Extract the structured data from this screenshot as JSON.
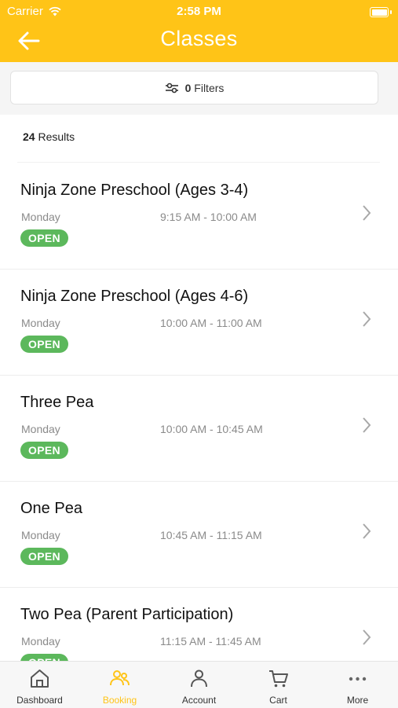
{
  "status_bar": {
    "carrier": "Carrier",
    "time": "2:58 PM"
  },
  "header": {
    "title": "Classes"
  },
  "filters": {
    "label": "Filters",
    "count": "0"
  },
  "results": {
    "count": "24",
    "label": "Results"
  },
  "classes": [
    {
      "name": "Ninja Zone Preschool (Ages 3-4)",
      "day": "Monday",
      "time": "9:15 AM - 10:00 AM",
      "status": "OPEN"
    },
    {
      "name": "Ninja Zone Preschool (Ages 4-6)",
      "day": "Monday",
      "time": "10:00 AM - 11:00 AM",
      "status": "OPEN"
    },
    {
      "name": "Three Pea",
      "day": "Monday",
      "time": "10:00 AM - 10:45 AM",
      "status": "OPEN"
    },
    {
      "name": "One Pea",
      "day": "Monday",
      "time": "10:45 AM - 11:15 AM",
      "status": "OPEN"
    },
    {
      "name": "Two Pea (Parent Participation)",
      "day": "Monday",
      "time": "11:15 AM - 11:45 AM",
      "status": "OPEN"
    }
  ],
  "tabs": [
    {
      "label": "Dashboard",
      "icon": "home-icon"
    },
    {
      "label": "Booking",
      "icon": "people-icon",
      "active": true
    },
    {
      "label": "Account",
      "icon": "person-icon"
    },
    {
      "label": "Cart",
      "icon": "cart-icon"
    },
    {
      "label": "More",
      "icon": "more-dots-icon"
    }
  ],
  "colors": {
    "accent": "#FFC417",
    "open_badge": "#5CB85C"
  }
}
